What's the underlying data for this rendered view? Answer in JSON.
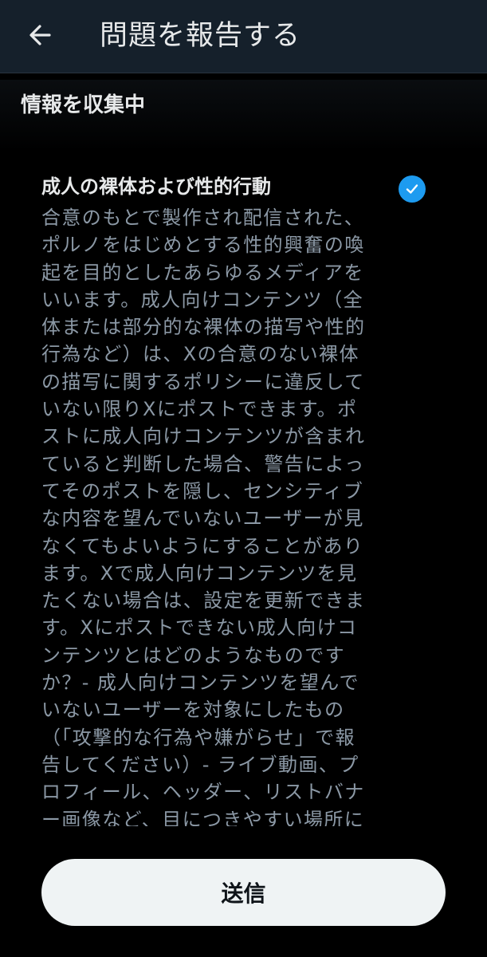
{
  "header": {
    "title": "問題を報告する",
    "back_icon": "arrow-left-icon"
  },
  "section": {
    "heading": "情報を収集中"
  },
  "option": {
    "title": "成人の裸体および性的行動",
    "selected": true,
    "check_icon": "checkmark-icon",
    "description": "合意のもとで製作され配信された、ポルノをはじめとする性的興奮の喚起を目的としたあらゆるメディアをいいます。成人向けコンテンツ（全体または部分的な裸体の描写や性的行為など）は、Xの合意のない裸体の描写に関するポリシーに違反していない限りXにポストできます。ポストに成人向けコンテンツが含まれていると判断した場合、警告によってそのポストを隠し、センシティブな内容を望んでいないユーザーが見なくてもよいようにすることがあります。Xで成人向けコンテンツを見たくない場合は、設定を更新できます。Xにポストできない成人向けコンテンツとはどのようなものですか？- 成人向けコンテンツを望んでいないユーザーを対象にしたもの（「攻撃的な行為や嫌がらせ」で報告してください）- ライブ動画、プロフィール、ヘッダー、リストバナー画像など、目につきやすい場所に表示された成人向けコンテンツ- 現実のものであれ演技で"
  },
  "footer": {
    "submit_label": "送信"
  },
  "colors": {
    "header_bg": "#15202b",
    "background": "#000000",
    "accent": "#1d9bf0",
    "text_primary": "#e7e9ea",
    "text_secondary": "#8b98a5",
    "button_bg": "#eff3f4"
  }
}
